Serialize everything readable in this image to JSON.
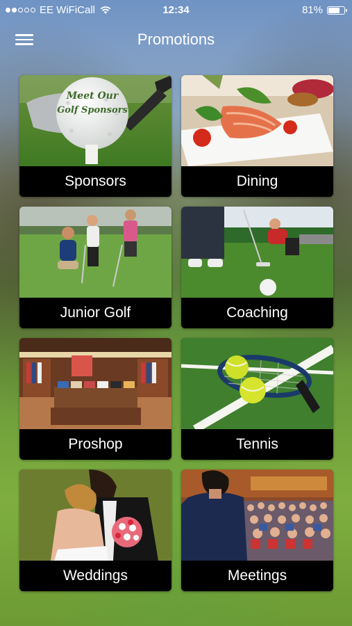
{
  "status_bar": {
    "carrier": "EE WiFiCall",
    "time": "12:34",
    "battery": "81%",
    "battery_level": 0.81,
    "signal_bars": 2,
    "signal_total": 5
  },
  "nav": {
    "title": "Promotions",
    "menu_icon": "hamburger-menu-icon"
  },
  "tiles": [
    {
      "label": "Sponsors",
      "photo_text": [
        "Meet Our",
        "Golf Sponsors"
      ]
    },
    {
      "label": "Dining"
    },
    {
      "label": "Junior Golf"
    },
    {
      "label": "Coaching"
    },
    {
      "label": "Proshop"
    },
    {
      "label": "Tennis"
    },
    {
      "label": "Weddings"
    },
    {
      "label": "Meetings"
    }
  ],
  "colors": {
    "label_bg": "#000000",
    "label_text": "#ffffff",
    "accent": "#ffffff"
  }
}
